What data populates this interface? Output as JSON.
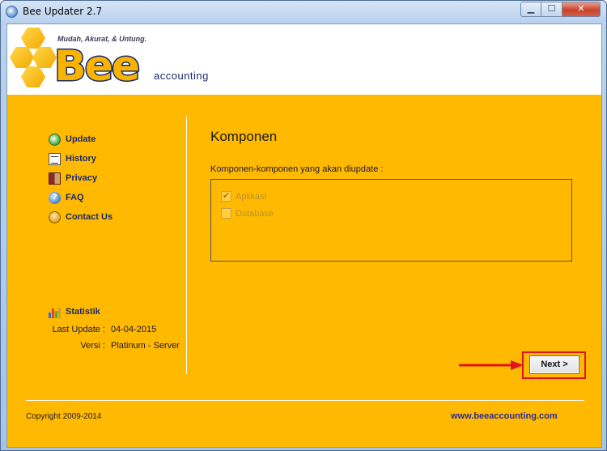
{
  "window": {
    "title": "Bee Updater 2.7",
    "controls": {
      "minimize": "▁",
      "maximize": "☐",
      "close": "✕"
    }
  },
  "header": {
    "tagline": "Mudah, Akurat, & Untung.",
    "logo_main": "Bee",
    "logo_sub": "accounting"
  },
  "nav": {
    "items": [
      {
        "label": "Update",
        "icon": "update-icon"
      },
      {
        "label": "History",
        "icon": "history-icon"
      },
      {
        "label": "Privacy",
        "icon": "privacy-icon"
      },
      {
        "label": "FAQ",
        "icon": "faq-icon"
      },
      {
        "label": "Contact Us",
        "icon": "contact-icon"
      }
    ]
  },
  "stats": {
    "title": "Statistik",
    "last_update_label": "Last Update :",
    "last_update_value": "04-04-2015",
    "version_label": "Versi :",
    "version_value": "Platinum - Server"
  },
  "main": {
    "section_title": "Komponen",
    "description": "Komponen-komponen yang akan diupdate :",
    "components": [
      {
        "label": "Aplikasi",
        "checked": true
      },
      {
        "label": "Database",
        "checked": false
      }
    ],
    "next_button": "Next >"
  },
  "footer": {
    "copyright": "Copyright 2009-2014",
    "website": "www.beeaccounting.com"
  },
  "colors": {
    "background": "#ffb900",
    "highlight": "#e3141b",
    "link": "#2b2b9a"
  }
}
